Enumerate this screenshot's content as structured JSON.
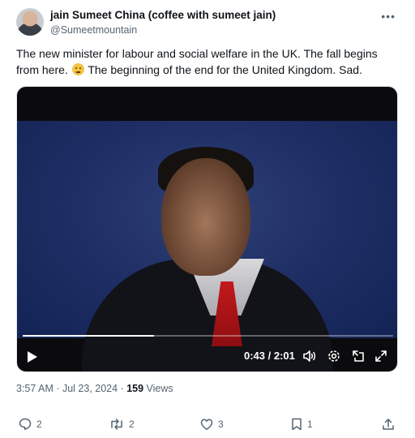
{
  "tweet": {
    "author": {
      "display_name": "jain Sumeet China (coffee with sumeet jain)",
      "handle": "@Sumeetmountain"
    },
    "text_part1": "The new minister for labour and social welfare in the UK. The fall begins from here.",
    "emoji_icon": "thinking-face-emoji",
    "text_part2": "The beginning of the end for the United Kingdom. Sad.",
    "video": {
      "time_display": "0:43 / 2:01",
      "progress_fraction": 0.355
    },
    "meta": {
      "timestamp": "3:57 AM · Jul 23, 2024",
      "separator": " · ",
      "views_count": "159",
      "views_label": " Views"
    },
    "actions": {
      "replies": "2",
      "reposts": "2",
      "likes": "3",
      "bookmarks": "1"
    }
  },
  "colors": {
    "text_primary": "#0f1419",
    "text_secondary": "#536471"
  },
  "icons": [
    "more-icon",
    "play-icon",
    "volume-icon",
    "settings-gear-icon",
    "pip-icon",
    "picture-in-picture-icon",
    "fullscreen-icon",
    "reply-icon",
    "repost-icon",
    "like-icon",
    "bookmark-icon",
    "share-icon"
  ]
}
